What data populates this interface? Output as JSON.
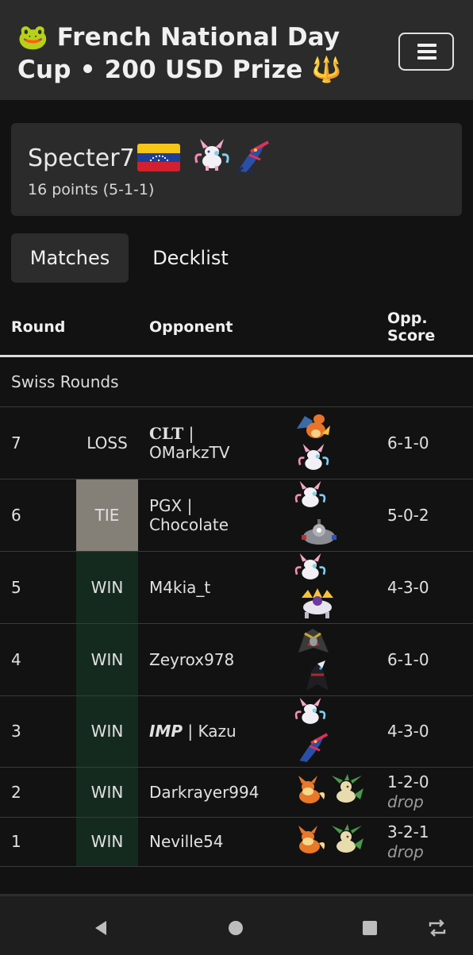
{
  "header": {
    "title": "🐸 French National Day Cup • 200 USD Prize 🔱",
    "menu_icon": "hamburger-icon"
  },
  "player": {
    "name": "Specter7",
    "flag": "venezuela-flag",
    "points": "16 points (5-1-1)",
    "sprites": [
      "sylveon",
      "greninja"
    ]
  },
  "tabs": [
    {
      "label": "Matches",
      "active": true
    },
    {
      "label": "Decklist",
      "active": false
    }
  ],
  "table": {
    "headers": {
      "round": "Round",
      "opponent": "Opponent",
      "opp_score": "Opp. Score"
    },
    "section": "Swiss Rounds",
    "rows": [
      {
        "round": "7",
        "result": "LOSS",
        "team": "CLT",
        "separator": "|",
        "opponent": "OMarkzTV",
        "score": "6-1-0",
        "drop": "",
        "sprites": [
          "charizard",
          "sylveon"
        ]
      },
      {
        "round": "6",
        "result": "TIE",
        "team": "PGX",
        "separator": "|",
        "opponent": "Chocolate",
        "score": "5-0-2",
        "drop": "",
        "sprites": [
          "sylveon",
          "magnezone"
        ]
      },
      {
        "round": "5",
        "result": "WIN",
        "team": "",
        "separator": "",
        "opponent": "M4kia_t",
        "score": "4-3-0",
        "drop": "",
        "sprites": [
          "sylveon",
          "solgaleo"
        ]
      },
      {
        "round": "4",
        "result": "WIN",
        "team": "",
        "separator": "",
        "opponent": "Zeyrox978",
        "score": "6-1-0",
        "drop": "",
        "sprites": [
          "giratina",
          "darkrai"
        ]
      },
      {
        "round": "3",
        "result": "WIN",
        "team": "IMP",
        "separator": "|",
        "opponent": "Kazu",
        "score": "4-3-0",
        "drop": "",
        "sprites": [
          "sylveon",
          "greninja"
        ]
      },
      {
        "round": "2",
        "result": "WIN",
        "team": "",
        "separator": "",
        "opponent": "Darkrayer994",
        "score": "1-2-0",
        "drop": "drop",
        "sprites": [
          "flareon",
          "leafeon"
        ]
      },
      {
        "round": "1",
        "result": "WIN",
        "team": "",
        "separator": "",
        "opponent": "Neville54",
        "score": "3-2-1",
        "drop": "drop",
        "sprites": [
          "flareon",
          "leafeon"
        ]
      }
    ]
  },
  "colors": {
    "win_bg": "#152a1e",
    "tie_bg": "#847f77",
    "loss_bg": "#121212"
  },
  "navbar": {
    "icons": [
      "back-icon",
      "home-icon",
      "recents-icon",
      "rotate-icon"
    ]
  }
}
